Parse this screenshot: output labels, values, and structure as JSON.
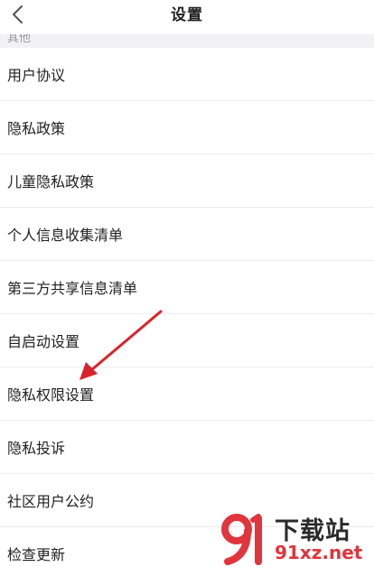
{
  "header": {
    "title": "设置",
    "back_icon": "chevron-left-icon"
  },
  "section": {
    "label": "其他"
  },
  "items": [
    {
      "label": "用户协议"
    },
    {
      "label": "隐私政策"
    },
    {
      "label": "儿童隐私政策"
    },
    {
      "label": "个人信息收集清单"
    },
    {
      "label": "第三方共享信息清单"
    },
    {
      "label": "自启动设置"
    },
    {
      "label": "隐私权限设置"
    },
    {
      "label": "隐私投诉"
    },
    {
      "label": "社区用户公约"
    },
    {
      "label": "检查更新"
    }
  ],
  "annotation": {
    "color": "#d9232b",
    "points_to": "隐私权限设置"
  },
  "watermark": {
    "logo_text": "91",
    "title": "下载站",
    "url": "91xz.net",
    "accent_color": "#e0353c"
  }
}
